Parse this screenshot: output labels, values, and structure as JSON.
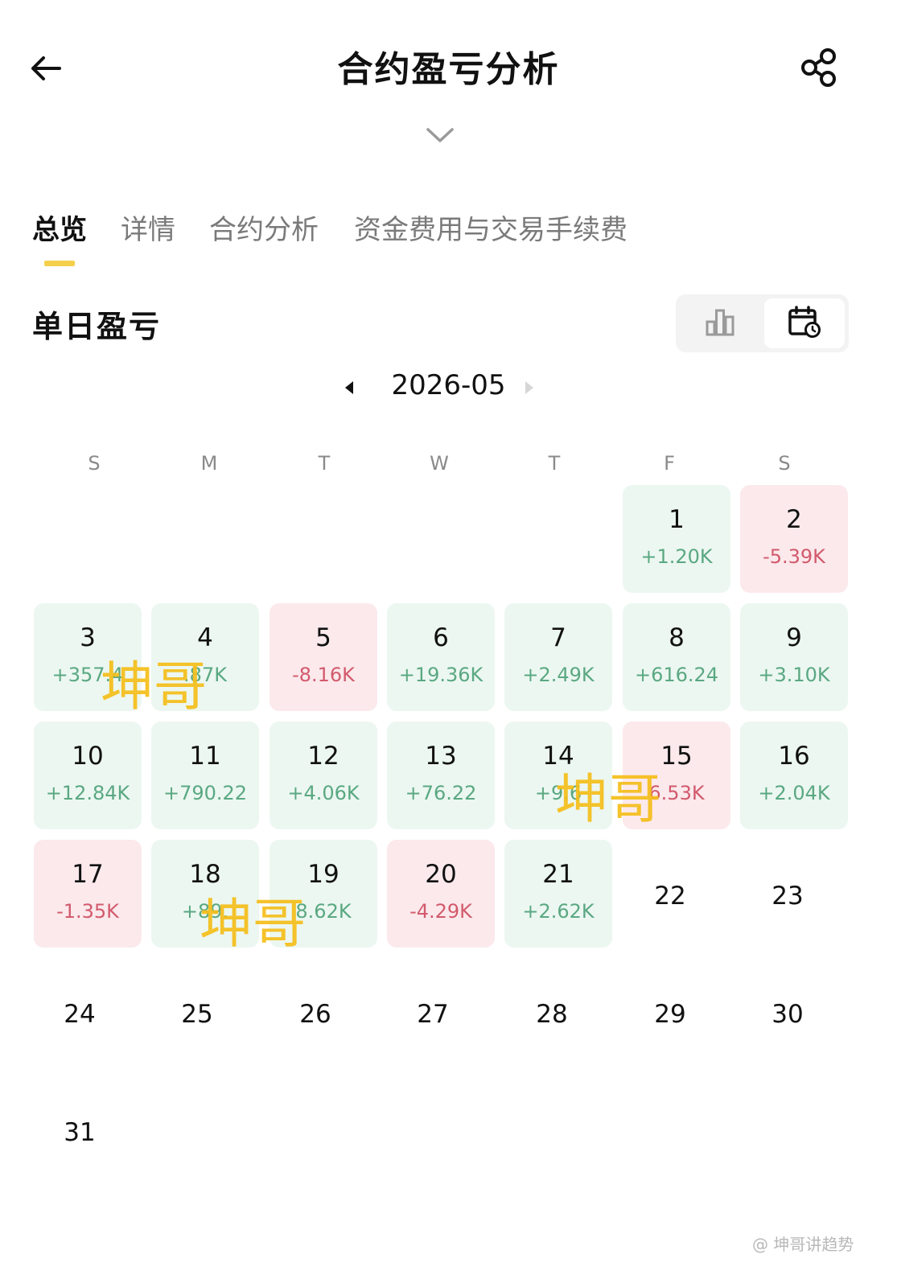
{
  "header": {
    "title": "合约盈亏分析"
  },
  "tabs": [
    {
      "label": "总览",
      "active": true
    },
    {
      "label": "详情",
      "active": false
    },
    {
      "label": "合约分析",
      "active": false
    },
    {
      "label": "资金费用与交易手续费",
      "active": false
    }
  ],
  "section": {
    "title": "单日盈亏"
  },
  "view_toggle": {
    "options": [
      "bar-chart-icon",
      "calendar-icon"
    ],
    "selected": "calendar-icon"
  },
  "month": {
    "label": "2026-05"
  },
  "weekdays": [
    "S",
    "M",
    "T",
    "W",
    "T",
    "F",
    "S"
  ],
  "colors": {
    "accent": "#f5d04b",
    "profit": "#5aa882",
    "loss": "#d25a6c",
    "profit_bg": "#ecf7f1",
    "loss_bg": "#fbe9ec"
  },
  "days": [
    {
      "day": "1",
      "pnl": "+1.20K",
      "type": "pos"
    },
    {
      "day": "2",
      "pnl": "-5.39K",
      "type": "neg"
    },
    {
      "day": "3",
      "pnl": "+357.4",
      "type": "pos"
    },
    {
      "day": "4",
      "pnl": ".87K",
      "type": "pos"
    },
    {
      "day": "5",
      "pnl": "-8.16K",
      "type": "neg"
    },
    {
      "day": "6",
      "pnl": "+19.36K",
      "type": "pos"
    },
    {
      "day": "7",
      "pnl": "+2.49K",
      "type": "pos"
    },
    {
      "day": "8",
      "pnl": "+616.24",
      "type": "pos"
    },
    {
      "day": "9",
      "pnl": "+3.10K",
      "type": "pos"
    },
    {
      "day": "10",
      "pnl": "+12.84K",
      "type": "pos"
    },
    {
      "day": "11",
      "pnl": "+790.22",
      "type": "pos"
    },
    {
      "day": "12",
      "pnl": "+4.06K",
      "type": "pos"
    },
    {
      "day": "13",
      "pnl": "+76.22",
      "type": "pos"
    },
    {
      "day": "14",
      "pnl": "+9.6",
      "type": "pos"
    },
    {
      "day": "15",
      "pnl": "6.53K",
      "type": "neg"
    },
    {
      "day": "16",
      "pnl": "+2.04K",
      "type": "pos"
    },
    {
      "day": "17",
      "pnl": "-1.35K",
      "type": "neg"
    },
    {
      "day": "18",
      "pnl": "+89.",
      "type": "pos"
    },
    {
      "day": "19",
      "pnl": "8.62K",
      "type": "pos"
    },
    {
      "day": "20",
      "pnl": "-4.29K",
      "type": "neg"
    },
    {
      "day": "21",
      "pnl": "+2.62K",
      "type": "pos"
    },
    {
      "day": "22",
      "pnl": "",
      "type": "plain"
    },
    {
      "day": "23",
      "pnl": "",
      "type": "plain"
    },
    {
      "day": "24",
      "pnl": "",
      "type": "plain"
    },
    {
      "day": "25",
      "pnl": "",
      "type": "plain"
    },
    {
      "day": "26",
      "pnl": "",
      "type": "plain"
    },
    {
      "day": "27",
      "pnl": "",
      "type": "plain"
    },
    {
      "day": "28",
      "pnl": "",
      "type": "plain"
    },
    {
      "day": "29",
      "pnl": "",
      "type": "plain"
    },
    {
      "day": "30",
      "pnl": "",
      "type": "plain"
    },
    {
      "day": "31",
      "pnl": "",
      "type": "plain"
    }
  ],
  "watermarks": [
    "坤哥",
    "坤哥",
    "坤哥"
  ],
  "credit": "@ 坤哥讲趋势"
}
